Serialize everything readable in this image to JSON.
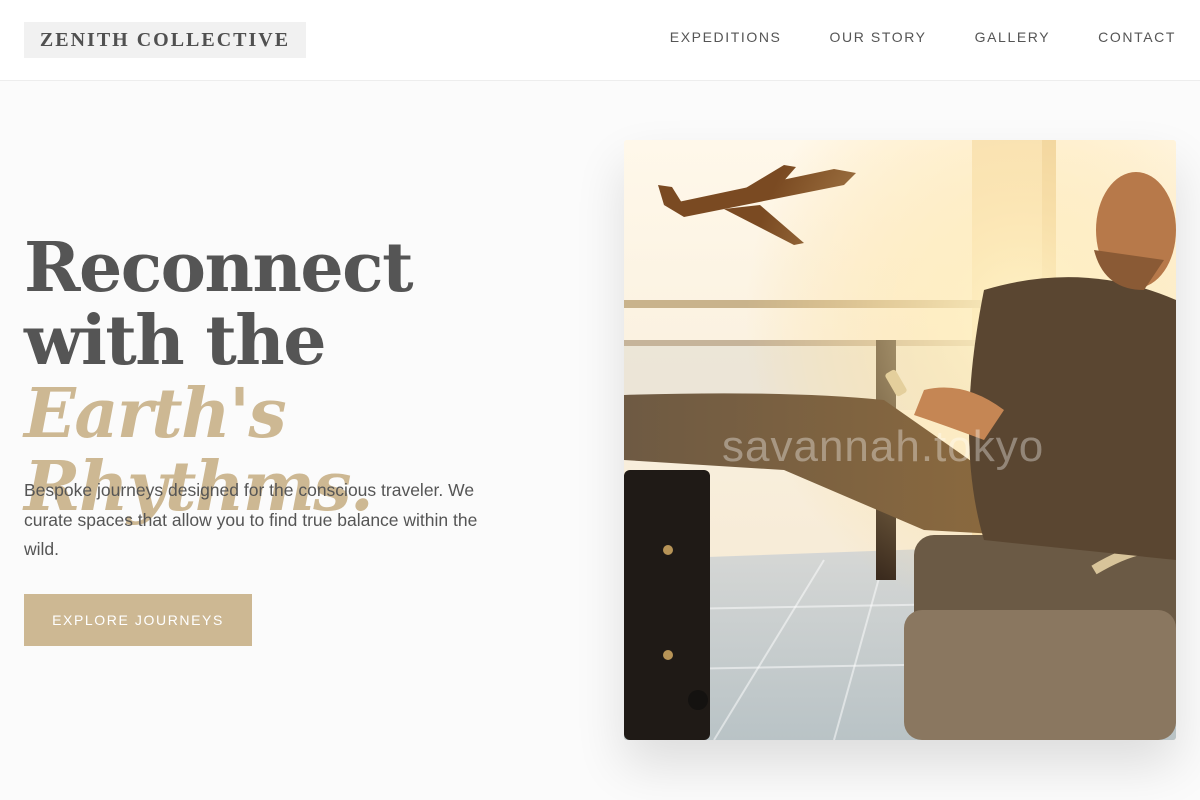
{
  "header": {
    "logo": "ZENITH COLLECTIVE",
    "nav": [
      "EXPEDITIONS",
      "OUR STORY",
      "GALLERY",
      "CONTACT"
    ]
  },
  "hero": {
    "title_line1": "Reconnect with the",
    "title_accent": "Earth's Rhythms.",
    "description": "Bespoke journeys designed for the conscious traveler. We curate spaces that allow you to find true balance within the wild.",
    "cta_label": "EXPLORE JOURNEYS",
    "image": {
      "watermark": "savannah.tokyo"
    }
  },
  "colors": {
    "accent": "#cdb893",
    "text": "#555555",
    "background": "#fbfbfb"
  }
}
